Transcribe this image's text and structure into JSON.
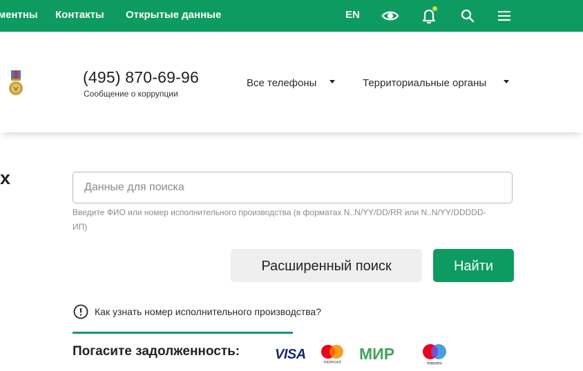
{
  "topbar": {
    "nav": [
      "ментны",
      "Контакты",
      "Открытые данные"
    ],
    "lang": "EN",
    "icons": [
      "eye-icon",
      "bell-icon",
      "search-icon",
      "menu-icon"
    ]
  },
  "header": {
    "phone": "(495) 870-69-96",
    "phone_sub": "Сообщение о коррупции",
    "dropdowns": [
      "Все телефоны",
      "Территориальные органы"
    ]
  },
  "page": {
    "cropped_title": "х"
  },
  "search": {
    "placeholder": "Данные для поиска",
    "hint": "Введите ФИО или номер исполнительного производства (в форматах N..N/YY/DD/RR или N..N/YY/DDDDD-ИП)",
    "advanced_label": "Расширенный поиск",
    "find_label": "Найти",
    "info_link": "Как узнать номер исполнительного производства?"
  },
  "payment": {
    "label": "Погасите задолженность:",
    "systems": {
      "visa": "VISA",
      "mastercard": "mastercard",
      "mir": "МИР",
      "maestro": "maestro"
    }
  },
  "colors": {
    "brand_green": "#0d9b62",
    "bell_dot": "#c5e03a",
    "visa_blue": "#1a2a6c",
    "mir_green": "#45a25d"
  }
}
